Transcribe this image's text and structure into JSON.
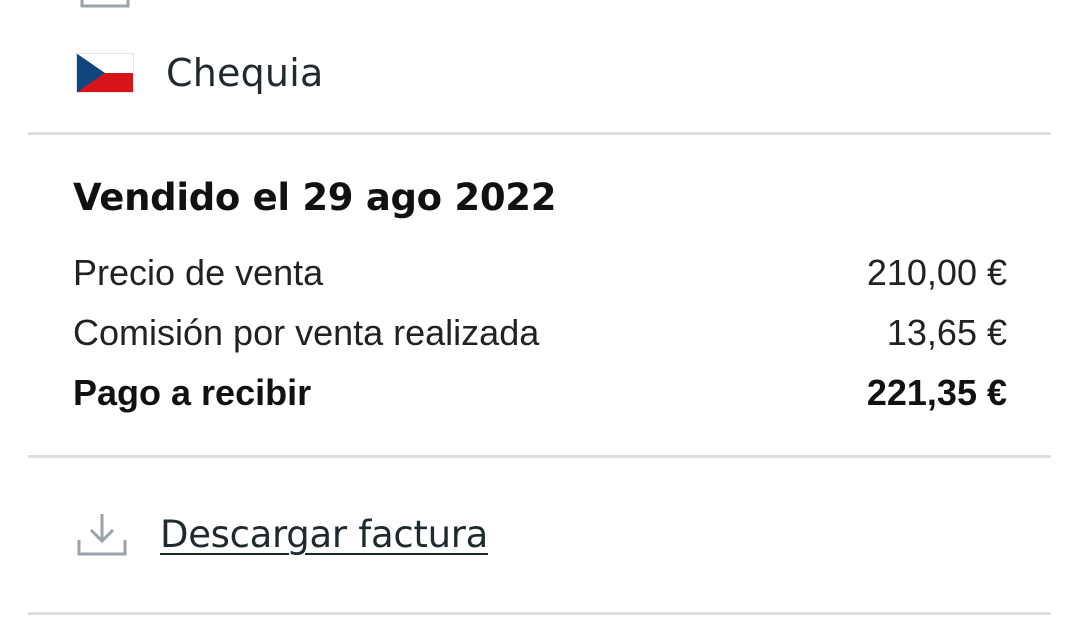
{
  "shipping": {
    "country": "Chequia",
    "flag_icon": "czech-flag-icon"
  },
  "sale": {
    "title": "Vendido el 29 ago 2022",
    "lines": [
      {
        "label": "Precio de venta",
        "amount": "210,00 €"
      },
      {
        "label": "Comisión por venta realizada",
        "amount": "13,65 €"
      },
      {
        "label": "Pago a recibir",
        "amount": "221,35 €"
      }
    ]
  },
  "actions": {
    "download_invoice_label": "Descargar factura",
    "download_icon": "download-icon"
  },
  "colors": {
    "divider": "#dcdfe0",
    "text": "#1a1a1a",
    "icon": "#9aa3a7",
    "flag_blue": "#11457e",
    "flag_red": "#d7141a"
  }
}
